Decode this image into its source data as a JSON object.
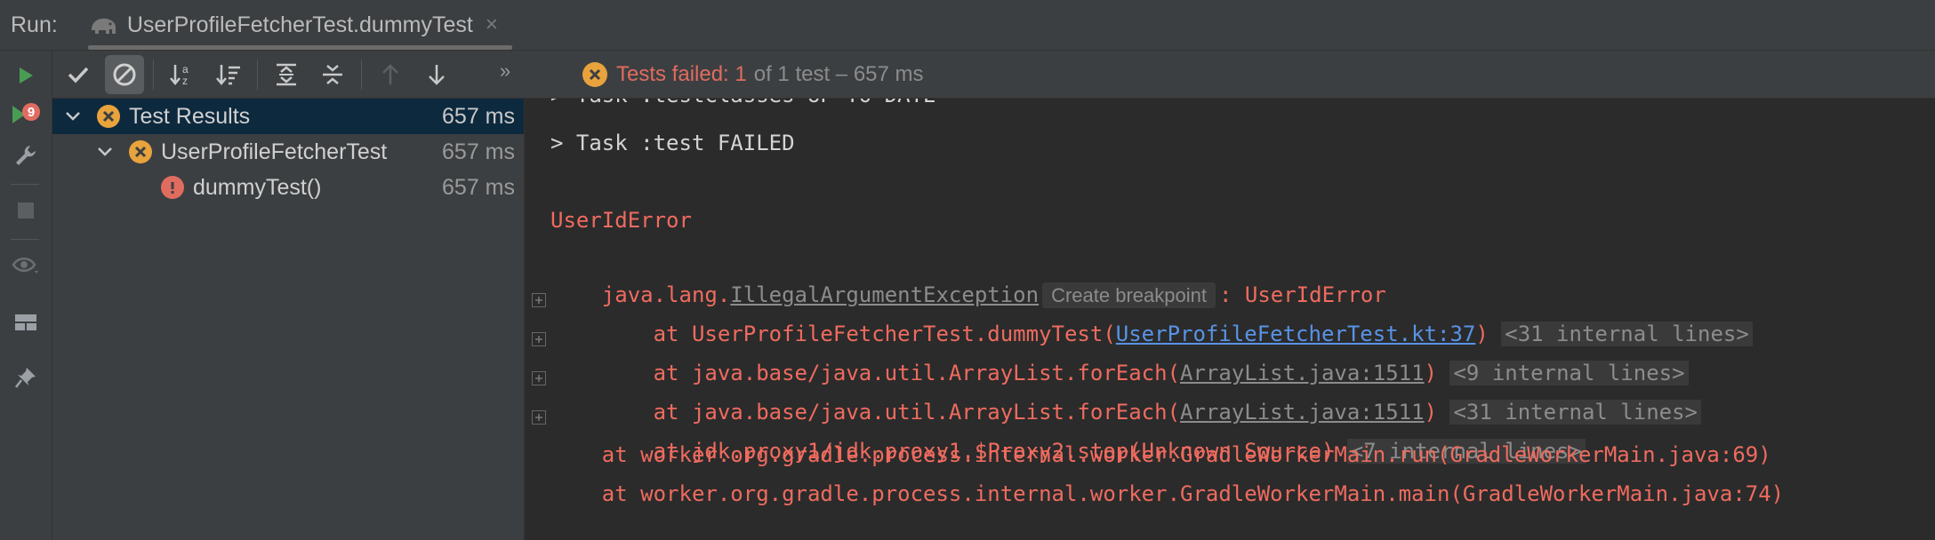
{
  "titlebar": {
    "run_label": "Run:",
    "tab_title": "UserProfileFetcherTest.dummyTest",
    "tab_close": "×"
  },
  "leftbar": {
    "icons": [
      "rerun-icon",
      "rerun-failed-icon",
      "wrench-icon",
      "stop-icon",
      "eye-icon",
      "layout-icon",
      "pin-icon"
    ],
    "rerun_badge": "9"
  },
  "toolbar": {
    "buttons": [
      "show-passed-icon",
      "show-ignored-icon",
      "sort-alpha-icon",
      "sort-duration-icon",
      "expand-all-icon",
      "collapse-all-icon",
      "prev-failed-icon",
      "next-failed-icon"
    ],
    "more": "»",
    "status_failed": "Tests failed: 1",
    "status_rest": "of 1 test – 657 ms"
  },
  "tree": {
    "rows": [
      {
        "label": "Test Results",
        "duration": "657 ms"
      },
      {
        "label": "UserProfileFetcherTest",
        "duration": "657 ms"
      },
      {
        "label": "dummyTest()",
        "duration": "657 ms"
      }
    ]
  },
  "console": {
    "line0": "> Task :testClasses UP-TO-DATE",
    "line1": "> Task :test FAILED",
    "error_title": "UserIdError",
    "exc_prefix": "java.lang.",
    "exc_link": "IllegalArgumentException",
    "breakpoint_hint": "Create breakpoint",
    "exc_suffix": ": UserIdError",
    "frames": [
      {
        "pre": "    at UserProfileFetcherTest.dummyTest(",
        "link": "UserProfileFetcherTest.kt:37",
        "post": ")",
        "hint": "<31 internal lines>"
      },
      {
        "pre": "    at java.base/java.util.ArrayList.forEach(",
        "link": "ArrayList.java:1511",
        "post": ")",
        "hint": "<9 internal lines>"
      },
      {
        "pre": "    at java.base/java.util.ArrayList.forEach(",
        "link": "ArrayList.java:1511",
        "post": ")",
        "hint": "<31 internal lines>"
      },
      {
        "pre": "    at jdk.proxy1/jdk.proxy1.$Proxy2.stop(Unknown Source)",
        "link": "",
        "post": "",
        "hint": "<7 internal lines>"
      }
    ],
    "frame5": "    at worker.org.gradle.process.internal.worker.GradleWorkerMain.run(GradleWorkerMain.java:69)",
    "frame6": "    at worker.org.gradle.process.internal.worker.GradleWorkerMain.main(GradleWorkerMain.java:74)"
  },
  "colors": {
    "fail": "#ef6b5f",
    "link": "#5893e6",
    "warning": "#e8a33d",
    "selection": "#0d293e"
  }
}
